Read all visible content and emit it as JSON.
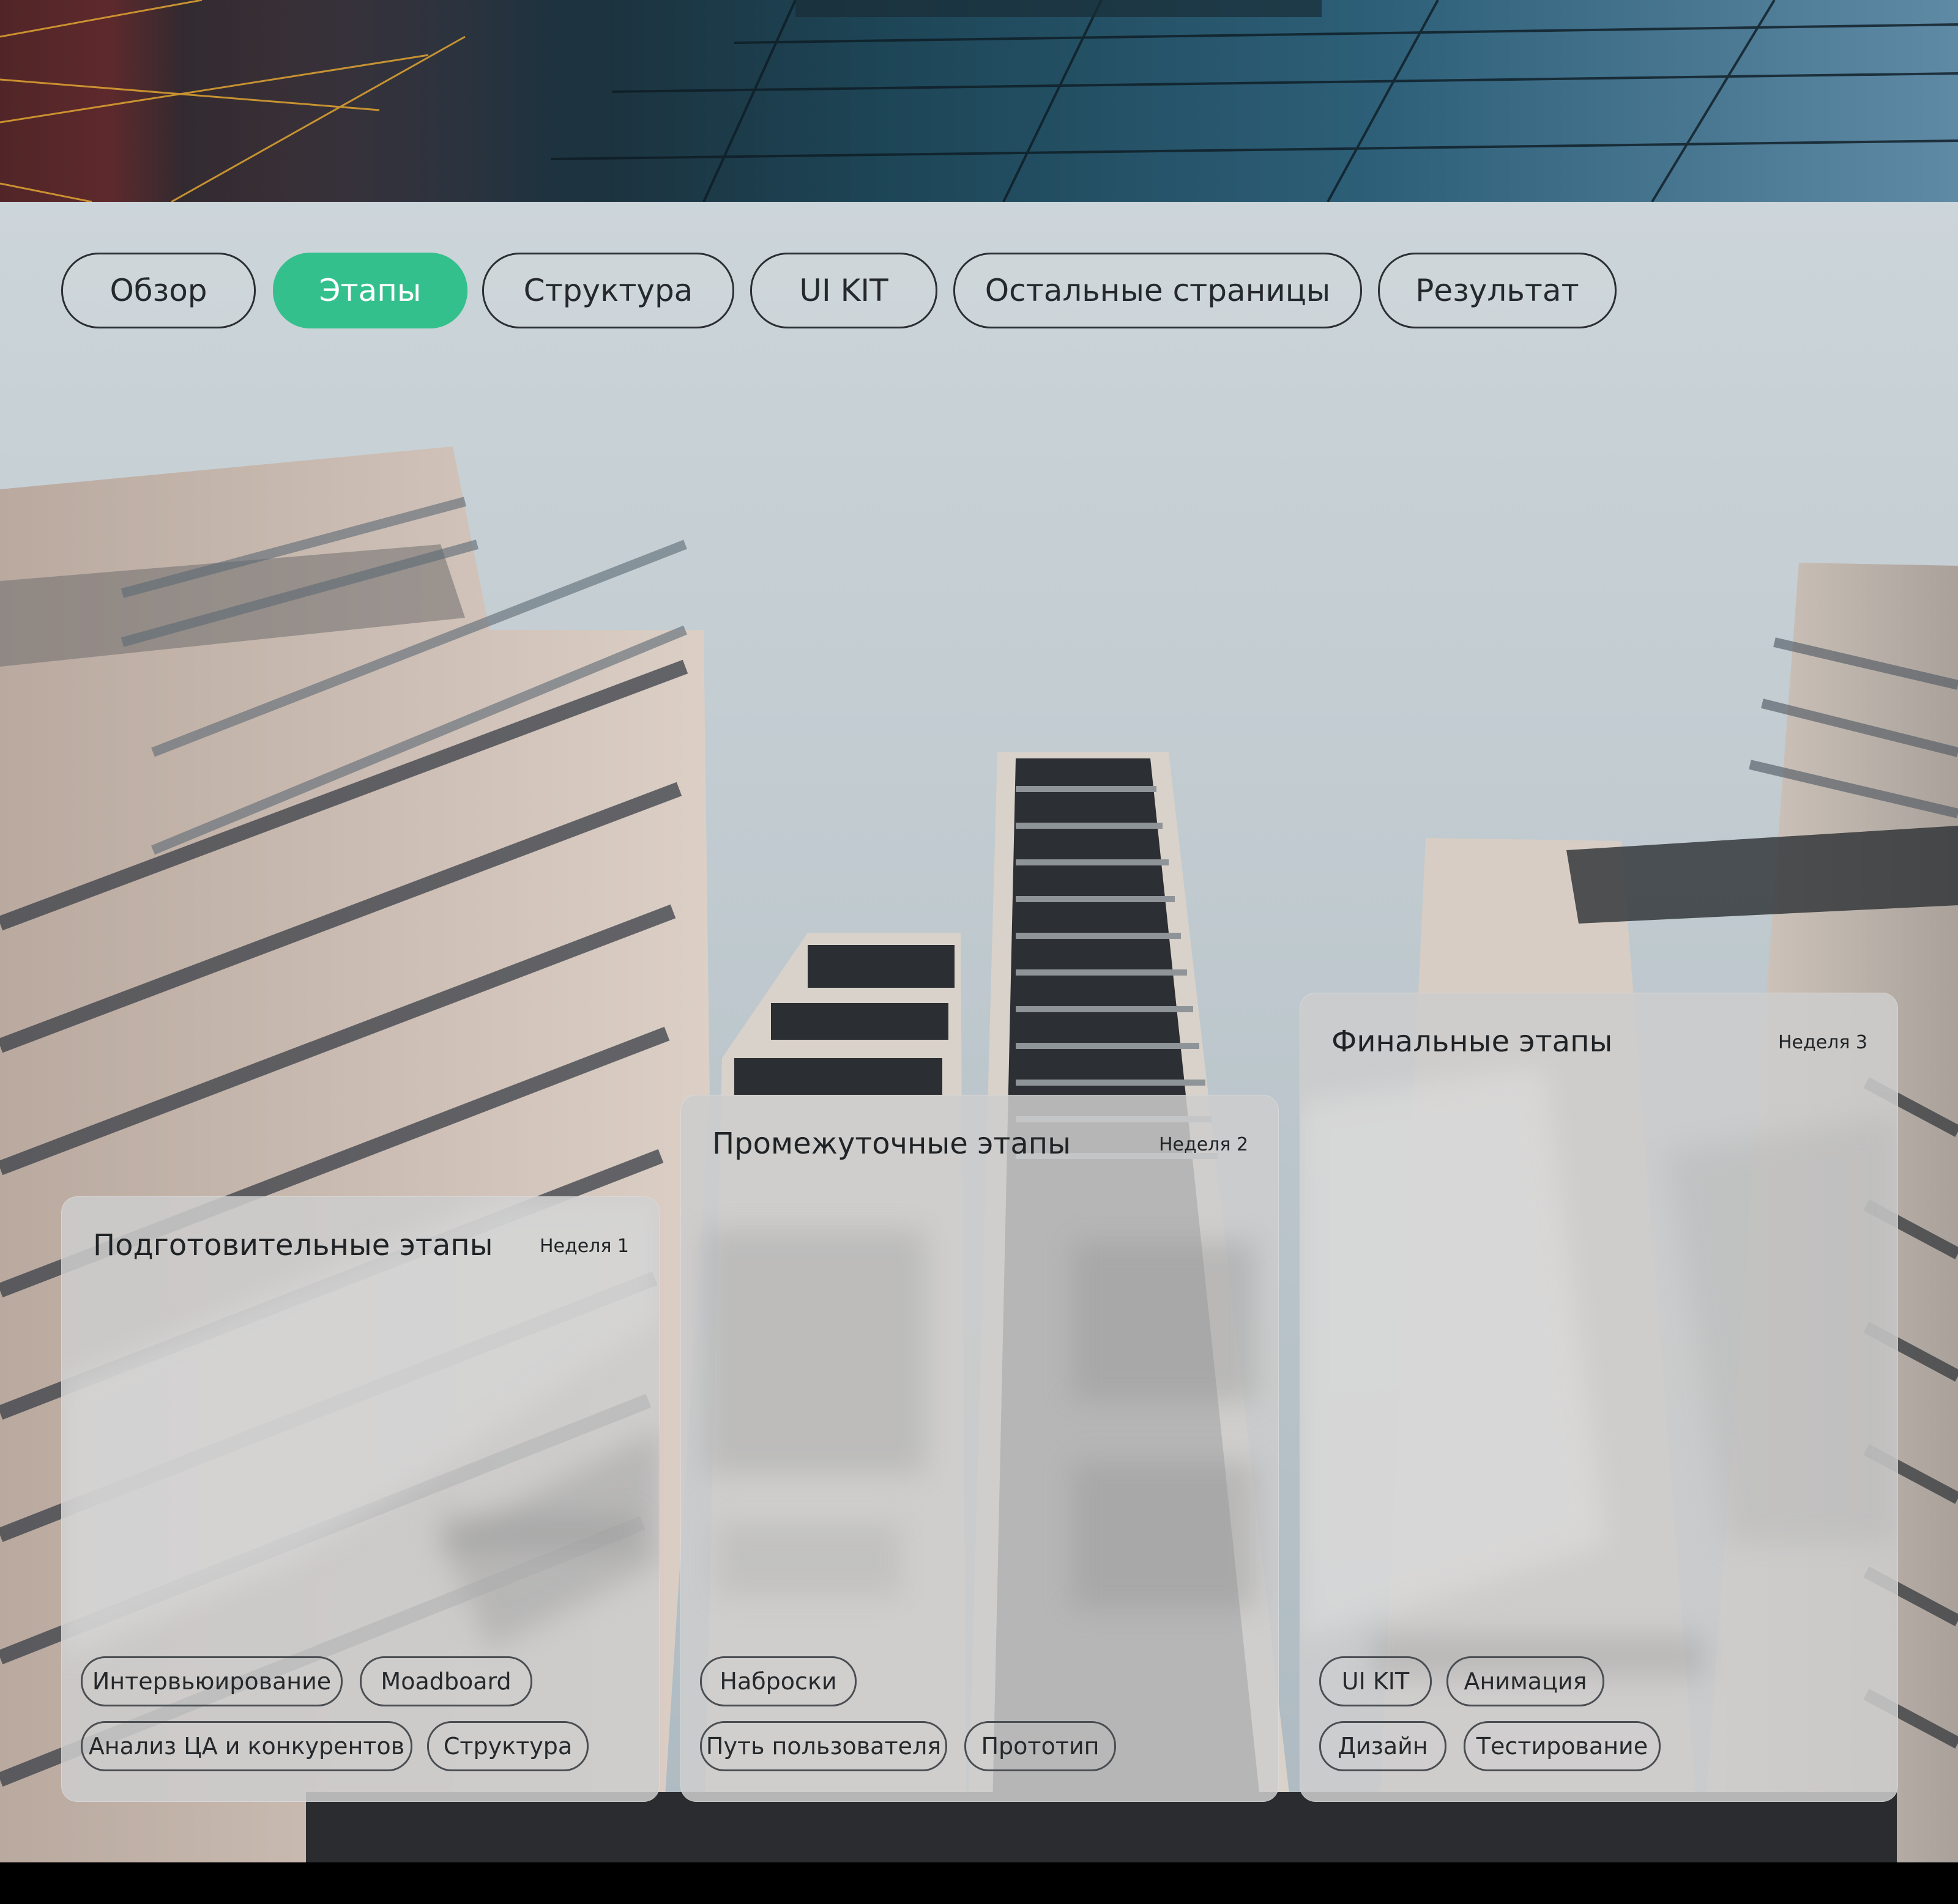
{
  "tabs": [
    {
      "label": "Обзор"
    },
    {
      "label": "Этапы"
    },
    {
      "label": "Структура"
    },
    {
      "label": "UI KIT"
    },
    {
      "label": "Остальные страницы"
    },
    {
      "label": "Результат"
    }
  ],
  "active_tab": "Этапы",
  "accent_color": "#34c08c",
  "cards": [
    {
      "title": "Подготовительные этапы",
      "week": "Неделя 1",
      "tags": [
        "Интервьюирование",
        "Moadboard",
        "Анализ ЦА и конкурентов",
        "Структура"
      ]
    },
    {
      "title": "Промежуточные этапы",
      "week": "Неделя 2",
      "tags": [
        "Наброски",
        "Путь пользователя",
        "Прототип"
      ]
    },
    {
      "title": "Финальные этапы",
      "week": "Неделя 3",
      "tags": [
        "UI KIT",
        "Анимация",
        "Дизайн",
        "Тестирование"
      ]
    }
  ]
}
